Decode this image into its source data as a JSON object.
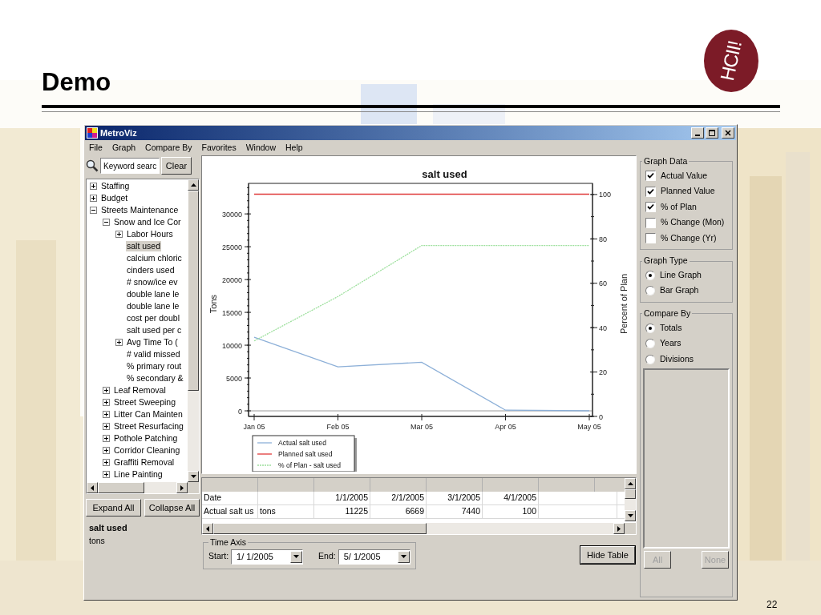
{
  "slide": {
    "title": "Demo",
    "logo": "HCII!",
    "page_number": "22"
  },
  "window": {
    "title": "MetroViz"
  },
  "menu": [
    "File",
    "Graph",
    "Compare By",
    "Favorites",
    "Window",
    "Help"
  ],
  "search": {
    "value": "Keyword searc",
    "button": "Clear"
  },
  "tree": {
    "items": [
      {
        "label": "Staffing",
        "kind": "group",
        "expanded": false,
        "selected": false
      },
      {
        "label": "Budget",
        "kind": "group",
        "expanded": false,
        "selected": false
      },
      {
        "label": "Streets Maintenance",
        "kind": "group",
        "expanded": true,
        "selected": false,
        "children": [
          {
            "label": "Snow and Ice Cor",
            "kind": "group",
            "expanded": true,
            "selected": false,
            "children": [
              {
                "label": "Labor Hours",
                "kind": "group",
                "expanded": false,
                "selected": false
              },
              {
                "label": "salt used",
                "kind": "leaf",
                "selected": true
              },
              {
                "label": "calcium chloric",
                "kind": "leaf",
                "selected": false
              },
              {
                "label": "cinders used",
                "kind": "leaf",
                "selected": false
              },
              {
                "label": "# snow/ice ev",
                "kind": "leaf",
                "selected": false
              },
              {
                "label": "double lane le",
                "kind": "leaf",
                "selected": false
              },
              {
                "label": "double lane le",
                "kind": "leaf",
                "selected": false
              },
              {
                "label": "cost per doubl",
                "kind": "leaf",
                "selected": false
              },
              {
                "label": "salt used per c",
                "kind": "leaf",
                "selected": false
              },
              {
                "label": "Avg Time To (",
                "kind": "group",
                "expanded": false,
                "selected": false
              },
              {
                "label": "# valid missed",
                "kind": "leaf",
                "selected": false
              },
              {
                "label": "% primary rout",
                "kind": "leaf",
                "selected": false
              },
              {
                "label": "% secondary &",
                "kind": "leaf",
                "selected": false
              }
            ]
          },
          {
            "label": "Leaf Removal",
            "kind": "group",
            "expanded": false,
            "selected": false
          },
          {
            "label": "Street Sweeping",
            "kind": "group",
            "expanded": false,
            "selected": false
          },
          {
            "label": "Litter Can Mainten",
            "kind": "group",
            "expanded": false,
            "selected": false
          },
          {
            "label": "Street Resurfacing",
            "kind": "group",
            "expanded": false,
            "selected": false
          },
          {
            "label": "Pothole Patching",
            "kind": "group",
            "expanded": false,
            "selected": false
          },
          {
            "label": "Corridor Cleaning",
            "kind": "group",
            "expanded": false,
            "selected": false
          },
          {
            "label": "Graffiti Removal",
            "kind": "group",
            "expanded": false,
            "selected": false
          },
          {
            "label": "Line Painting",
            "kind": "group",
            "expanded": false,
            "selected": false
          }
        ]
      }
    ]
  },
  "tree_buttons": [
    "Expand All",
    "Collapse All"
  ],
  "selection_info": {
    "name": "salt used",
    "unit": "tons"
  },
  "chart": {
    "chart_data": {
      "type": "line",
      "title": "salt used",
      "ylabel": "Tons",
      "y2label": "Percent of Plan",
      "categories": [
        "Jan 05",
        "Feb 05",
        "Mar 05",
        "Apr 05",
        "May 05"
      ],
      "ylim": [
        -850,
        34650
      ],
      "y2lim": [
        0,
        105
      ],
      "legend": "below-left",
      "yticks": [
        0,
        5000,
        10000,
        15000,
        20000,
        25000,
        30000
      ],
      "y2ticks": [
        0,
        20,
        40,
        60,
        80,
        100
      ],
      "series": [
        {
          "name": "Actual salt used",
          "color": "#8db0d8",
          "axis": "y",
          "line_style": "solid",
          "values": [
            11200,
            6700,
            7400,
            100,
            0
          ]
        },
        {
          "name": "Planned salt used",
          "color": "#e03a3a",
          "axis": "y",
          "line_style": "solid",
          "values": [
            33000,
            33000,
            33000,
            33000,
            33000
          ]
        },
        {
          "name": "% of Plan - salt used",
          "color": "#9ee09e",
          "axis": "y2",
          "line_style": "dotted",
          "values": [
            34,
            54,
            77,
            77,
            77
          ]
        }
      ]
    }
  },
  "table": {
    "rows": [
      {
        "label": "Date",
        "values": [
          "1/1/2005",
          "2/1/2005",
          "3/1/2005",
          "4/1/2005"
        ]
      },
      {
        "label": "Actual salt us",
        "unit": "tons",
        "values": [
          "11225",
          "6669",
          "7440",
          "100"
        ]
      }
    ]
  },
  "time_axis": {
    "title": "Time Axis",
    "start_label": "Start:",
    "start": "1/ 1/2005",
    "end_label": "End:",
    "end": "5/ 1/2005"
  },
  "hide_table_button": "Hide Table",
  "graph_data": {
    "title": "Graph Data",
    "options": [
      {
        "label": "Actual Value",
        "checked": true
      },
      {
        "label": "Planned Value",
        "checked": true
      },
      {
        "label": "% of Plan",
        "checked": true
      },
      {
        "label": "% Change (Mon)",
        "checked": false
      },
      {
        "label": "% Change (Yr)",
        "checked": false
      }
    ]
  },
  "graph_type": {
    "title": "Graph Type",
    "options": [
      {
        "label": "Line Graph",
        "selected": true
      },
      {
        "label": "Bar Graph",
        "selected": false
      }
    ]
  },
  "compare_by": {
    "title": "Compare By",
    "options": [
      {
        "label": "Totals",
        "selected": true
      },
      {
        "label": "Years",
        "selected": false
      },
      {
        "label": "Divisions",
        "selected": false
      }
    ],
    "buttons": [
      {
        "label": "All",
        "disabled": true
      },
      {
        "label": "None",
        "disabled": true
      }
    ]
  }
}
